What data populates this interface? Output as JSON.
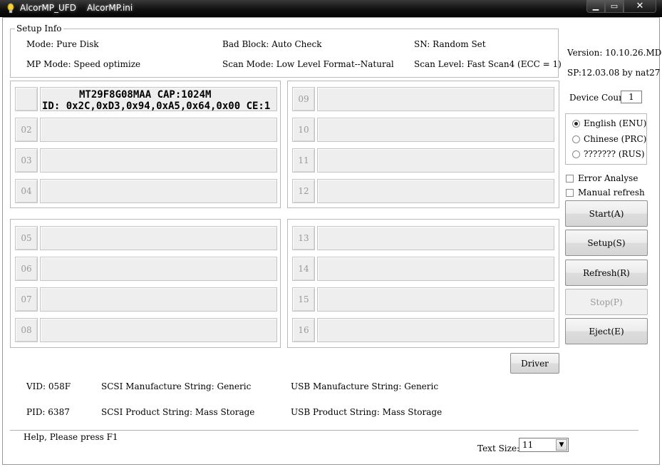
{
  "window": {
    "app_name": "AlcorMP_UFD",
    "ini_name": "AlcorMP.ini",
    "buttons": {
      "minimize": "▁",
      "maximize": "▭",
      "close": "✕"
    }
  },
  "setup_info": {
    "legend": "Setup Info",
    "mode": "Mode: Pure Disk",
    "bad_block": "Bad Block: Auto Check",
    "sn": "SN: Random Set",
    "mp_mode": "MP Mode: Speed optimize",
    "scan_mode": "Scan Mode: Low Level Format--Natural",
    "scan_level": "Scan Level: Fast Scan4 (ECC = 1)"
  },
  "version": "Version: 10.10.26.MD",
  "sp": "SP:12.03.08 by nat27",
  "device_count": {
    "label": "Device Count:",
    "value": "1"
  },
  "ports": [
    {
      "num": "",
      "line1": "MT29F8G08MAA CAP:1024M",
      "line2": "ID: 0x2C,0xD3,0x94,0xA5,0x64,0x00  CE:1"
    },
    {
      "num": "02"
    },
    {
      "num": "03"
    },
    {
      "num": "04"
    },
    {
      "num": "05"
    },
    {
      "num": "06"
    },
    {
      "num": "07"
    },
    {
      "num": "08"
    },
    {
      "num": "09"
    },
    {
      "num": "10"
    },
    {
      "num": "11"
    },
    {
      "num": "12"
    },
    {
      "num": "13"
    },
    {
      "num": "14"
    },
    {
      "num": "15"
    },
    {
      "num": "16"
    }
  ],
  "languages": [
    {
      "label": "English (ENU)",
      "selected": true
    },
    {
      "label": "Chinese (PRC)",
      "selected": false
    },
    {
      "label": "??????? (RUS)",
      "selected": false
    }
  ],
  "options": {
    "error_analyse": {
      "label": "Error Analyse",
      "checked": false
    },
    "manual_refresh": {
      "label": "Manual refresh",
      "checked": false
    }
  },
  "buttons": {
    "start": "Start(A)",
    "setup": "Setup(S)",
    "refresh": "Refresh(R)",
    "stop": "Stop(P)",
    "eject": "Eject(E)",
    "driver": "Driver"
  },
  "usb_info": {
    "vid": "VID:  058F",
    "pid": "PID:  6387",
    "scsi_manufacture": "SCSI Manufacture String:  Generic",
    "scsi_product": "SCSI Product String:  Mass Storage",
    "usb_manufacture": "USB Manufacture String:  Generic",
    "usb_product": "USB Product String:  Mass Storage"
  },
  "status": {
    "help": "Help, Please press F1"
  },
  "text_size": {
    "label": "Text Size:",
    "value": "11"
  }
}
